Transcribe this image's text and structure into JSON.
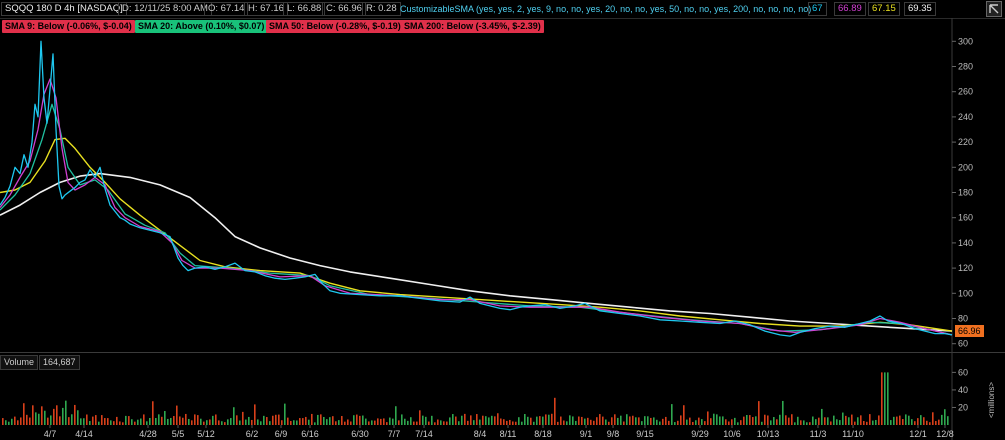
{
  "infobar": {
    "symbol": "SQQQ 180 D 4h [NASDAQ]",
    "date": "D: 12/11/25 8:00 AM",
    "open": "O: 67.14",
    "high": "H: 67.16",
    "low": "L: 66.88",
    "close": "C: 66.96",
    "range": "R: 0.28",
    "study": "CustomizableSMA (yes, yes, 2, yes, 9, no, no, yes, 20, no, no, yes, 50, no, no, yes, 200, no, no, no, no)",
    "study_values": [
      "67",
      "66.89",
      "67.15",
      "69.35"
    ]
  },
  "badges": [
    {
      "text": "SMA 9: Below (-0.06%, $-0.04)",
      "color": "#e0304a"
    },
    {
      "text": "SMA 20: Above (0.10%, $0.07)",
      "color": "#19c27a"
    },
    {
      "text": "SMA 50: Below (-0.28%, $-0.19)",
      "color": "#e0304a"
    },
    {
      "text": "SMA 200: Below (-3.45%, $-2.39)",
      "color": "#e0304a"
    }
  ],
  "volume": {
    "label": "Volume",
    "value": "164,687",
    "unit_label": "<millions>"
  },
  "last_price": "66.96",
  "colors": {
    "price": "#1ec8f0",
    "sma9": "#d040d0",
    "sma20": "#20c0a0",
    "sma50": "#e8e020",
    "sma200": "#f0f0f0",
    "up": "#2fa84f",
    "down": "#d8401a"
  },
  "chart_data": {
    "type": "line",
    "price_axis": {
      "ticks": [
        60,
        80,
        100,
        120,
        140,
        160,
        180,
        200,
        220,
        240,
        260,
        280,
        300
      ],
      "ylim": [
        55,
        305
      ]
    },
    "volume_axis": {
      "ticks": [
        20,
        40,
        60
      ],
      "ylim": [
        0,
        65
      ]
    },
    "x_ticks": [
      "4/7",
      "4/14",
      "4/28",
      "5/5",
      "5/12",
      "6/2",
      "6/9",
      "6/16",
      "6/30",
      "7/7",
      "7/14",
      "8/4",
      "8/11",
      "8/18",
      "9/1",
      "9/8",
      "9/15",
      "9/29",
      "10/6",
      "10/13",
      "11/3",
      "11/10",
      "12/1",
      "12/8"
    ],
    "series": [
      {
        "key": "price",
        "values": [
          [
            0,
            170
          ],
          [
            5,
            176
          ],
          [
            10,
            185
          ],
          [
            15,
            200
          ],
          [
            20,
            195
          ],
          [
            24,
            210
          ],
          [
            28,
            200
          ],
          [
            32,
            220
          ],
          [
            35,
            250
          ],
          [
            38,
            240
          ],
          [
            41,
            300
          ],
          [
            44,
            255
          ],
          [
            47,
            235
          ],
          [
            50,
            262
          ],
          [
            53,
            290
          ],
          [
            56,
            230
          ],
          [
            59,
            185
          ],
          [
            62,
            175
          ],
          [
            65,
            178
          ],
          [
            70,
            181
          ],
          [
            75,
            184
          ],
          [
            80,
            188
          ],
          [
            85,
            190
          ],
          [
            90,
            198
          ],
          [
            95,
            192
          ],
          [
            100,
            200
          ],
          [
            105,
            183
          ],
          [
            110,
            170
          ],
          [
            115,
            165
          ],
          [
            120,
            160
          ],
          [
            125,
            158
          ],
          [
            130,
            155
          ],
          [
            140,
            152
          ],
          [
            150,
            150
          ],
          [
            160,
            148
          ],
          [
            170,
            145
          ],
          [
            178,
            128
          ],
          [
            183,
            122
          ],
          [
            188,
            118
          ],
          [
            195,
            120
          ],
          [
            205,
            121
          ],
          [
            215,
            119
          ],
          [
            225,
            121
          ],
          [
            235,
            124
          ],
          [
            245,
            118
          ],
          [
            255,
            117
          ],
          [
            265,
            114
          ],
          [
            275,
            112
          ],
          [
            285,
            111
          ],
          [
            295,
            112
          ],
          [
            305,
            113
          ],
          [
            315,
            115
          ],
          [
            322,
            108
          ],
          [
            330,
            102
          ],
          [
            340,
            100
          ],
          [
            360,
            99
          ],
          [
            380,
            98
          ],
          [
            400,
            98
          ],
          [
            420,
            96
          ],
          [
            440,
            94
          ],
          [
            460,
            93
          ],
          [
            470,
            97
          ],
          [
            480,
            92
          ],
          [
            490,
            90
          ],
          [
            500,
            88
          ],
          [
            510,
            87
          ],
          [
            520,
            89
          ],
          [
            530,
            90
          ],
          [
            545,
            91
          ],
          [
            560,
            88
          ],
          [
            575,
            90
          ],
          [
            585,
            92
          ],
          [
            600,
            86
          ],
          [
            620,
            84
          ],
          [
            640,
            82
          ],
          [
            660,
            79
          ],
          [
            680,
            78
          ],
          [
            700,
            77
          ],
          [
            720,
            76
          ],
          [
            735,
            78
          ],
          [
            750,
            75
          ],
          [
            765,
            70
          ],
          [
            780,
            67
          ],
          [
            790,
            66
          ],
          [
            800,
            69
          ],
          [
            815,
            72
          ],
          [
            830,
            74
          ],
          [
            845,
            73
          ],
          [
            860,
            76
          ],
          [
            870,
            78
          ],
          [
            880,
            82
          ],
          [
            888,
            78
          ],
          [
            895,
            77
          ],
          [
            905,
            75
          ],
          [
            915,
            72
          ],
          [
            925,
            70
          ],
          [
            935,
            68
          ],
          [
            945,
            68
          ],
          [
            952,
            67
          ]
        ]
      },
      {
        "key": "sma9",
        "values": [
          [
            0,
            168
          ],
          [
            10,
            178
          ],
          [
            20,
            192
          ],
          [
            30,
            205
          ],
          [
            38,
            230
          ],
          [
            44,
            258
          ],
          [
            50,
            270
          ],
          [
            56,
            255
          ],
          [
            62,
            215
          ],
          [
            68,
            188
          ],
          [
            75,
            182
          ],
          [
            85,
            186
          ],
          [
            95,
            192
          ],
          [
            105,
            186
          ],
          [
            115,
            168
          ],
          [
            125,
            160
          ],
          [
            140,
            153
          ],
          [
            160,
            149
          ],
          [
            172,
            140
          ],
          [
            182,
            126
          ],
          [
            195,
            120
          ],
          [
            220,
            120
          ],
          [
            250,
            118
          ],
          [
            280,
            113
          ],
          [
            310,
            114
          ],
          [
            325,
            106
          ],
          [
            350,
            100
          ],
          [
            400,
            98
          ],
          [
            440,
            95
          ],
          [
            470,
            95
          ],
          [
            500,
            90
          ],
          [
            530,
            89
          ],
          [
            560,
            89
          ],
          [
            590,
            89
          ],
          [
            620,
            85
          ],
          [
            660,
            81
          ],
          [
            700,
            78
          ],
          [
            740,
            76
          ],
          [
            770,
            71
          ],
          [
            795,
            69
          ],
          [
            830,
            72
          ],
          [
            860,
            75
          ],
          [
            880,
            80
          ],
          [
            900,
            77
          ],
          [
            925,
            72
          ],
          [
            952,
            67
          ]
        ]
      },
      {
        "key": "sma20",
        "values": [
          [
            0,
            166
          ],
          [
            15,
            178
          ],
          [
            30,
            195
          ],
          [
            42,
            222
          ],
          [
            52,
            250
          ],
          [
            60,
            230
          ],
          [
            68,
            200
          ],
          [
            80,
            186
          ],
          [
            95,
            190
          ],
          [
            108,
            182
          ],
          [
            125,
            163
          ],
          [
            145,
            154
          ],
          [
            165,
            148
          ],
          [
            180,
            132
          ],
          [
            195,
            122
          ],
          [
            230,
            120
          ],
          [
            270,
            116
          ],
          [
            310,
            114
          ],
          [
            330,
            106
          ],
          [
            370,
            99
          ],
          [
            430,
            96
          ],
          [
            480,
            93
          ],
          [
            530,
            90
          ],
          [
            580,
            89
          ],
          [
            630,
            84
          ],
          [
            690,
            79
          ],
          [
            740,
            76
          ],
          [
            780,
            70
          ],
          [
            820,
            71
          ],
          [
            870,
            77
          ],
          [
            900,
            76
          ],
          [
            930,
            71
          ],
          [
            952,
            67
          ]
        ]
      },
      {
        "key": "sma50",
        "values": [
          [
            0,
            180
          ],
          [
            15,
            182
          ],
          [
            30,
            188
          ],
          [
            45,
            205
          ],
          [
            55,
            222
          ],
          [
            65,
            223
          ],
          [
            75,
            215
          ],
          [
            90,
            200
          ],
          [
            105,
            188
          ],
          [
            120,
            175
          ],
          [
            140,
            162
          ],
          [
            160,
            150
          ],
          [
            180,
            138
          ],
          [
            200,
            126
          ],
          [
            225,
            121
          ],
          [
            260,
            118
          ],
          [
            300,
            116
          ],
          [
            330,
            108
          ],
          [
            360,
            102
          ],
          [
            400,
            99
          ],
          [
            440,
            97
          ],
          [
            480,
            95
          ],
          [
            520,
            93
          ],
          [
            560,
            91
          ],
          [
            600,
            89
          ],
          [
            640,
            86
          ],
          [
            680,
            82
          ],
          [
            720,
            79
          ],
          [
            760,
            76
          ],
          [
            800,
            74
          ],
          [
            840,
            74
          ],
          [
            880,
            77
          ],
          [
            910,
            75
          ],
          [
            952,
            70
          ]
        ]
      },
      {
        "key": "sma200",
        "values": [
          [
            0,
            162
          ],
          [
            20,
            170
          ],
          [
            40,
            180
          ],
          [
            60,
            188
          ],
          [
            80,
            193
          ],
          [
            100,
            195
          ],
          [
            130,
            192
          ],
          [
            160,
            186
          ],
          [
            190,
            176
          ],
          [
            215,
            160
          ],
          [
            235,
            145
          ],
          [
            260,
            136
          ],
          [
            290,
            128
          ],
          [
            320,
            122
          ],
          [
            350,
            117
          ],
          [
            390,
            112
          ],
          [
            430,
            107
          ],
          [
            470,
            102
          ],
          [
            510,
            98
          ],
          [
            550,
            95
          ],
          [
            590,
            92
          ],
          [
            630,
            89
          ],
          [
            670,
            86
          ],
          [
            710,
            84
          ],
          [
            750,
            81
          ],
          [
            790,
            78
          ],
          [
            830,
            76
          ],
          [
            870,
            74
          ],
          [
            910,
            72
          ],
          [
            952,
            70
          ]
        ]
      }
    ]
  }
}
